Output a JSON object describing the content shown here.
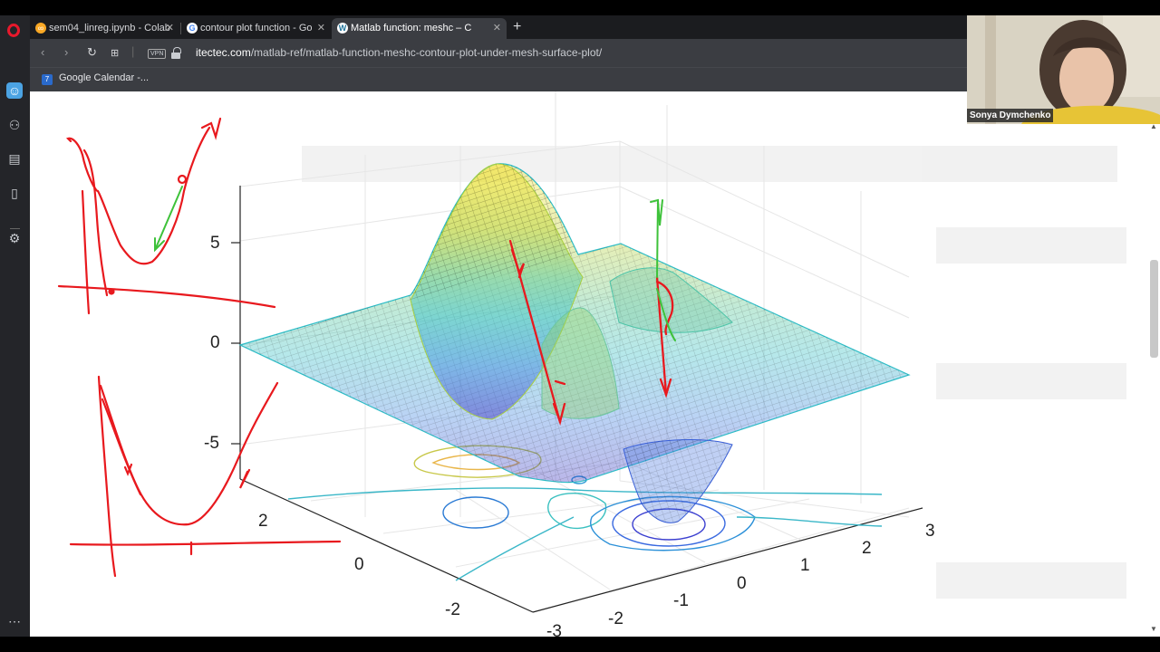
{
  "browser": {
    "tabs": [
      {
        "title": "sem04_linreg.ipynb - Colab",
        "icon": "colab-icon"
      },
      {
        "title": "contour plot function - Go",
        "icon": "google-icon"
      },
      {
        "title": "Matlab function: meshc – C",
        "icon": "wordpress-icon"
      }
    ],
    "new_tab_label": "+",
    "close_glyph": "✕",
    "url_domain": "itectec.com",
    "url_path": "/matlab-ref/matlab-function-meshc-contour-plot-under-mesh-surface-plot/",
    "vpn_label": "VPN",
    "bookmark": {
      "label": "Google Calendar -...",
      "icon_text": "7"
    }
  },
  "webcam": {
    "name": "Sonya Dymchenko"
  },
  "chart_data": {
    "type": "surface-mesh-with-contour",
    "z_ticks": [
      "5",
      "0",
      "-5"
    ],
    "y_ticks": [
      "2",
      "0",
      "-2"
    ],
    "x_ticks": [
      "-3",
      "-2",
      "-1",
      "0",
      "1",
      "2",
      "3"
    ],
    "colormap": "parula",
    "grid": true
  },
  "colors": {
    "annotation_red": "#e8191e",
    "annotation_green": "#3ec23a",
    "sidebar_accent": "#4ba3e3",
    "opera_red": "#e8192c"
  }
}
